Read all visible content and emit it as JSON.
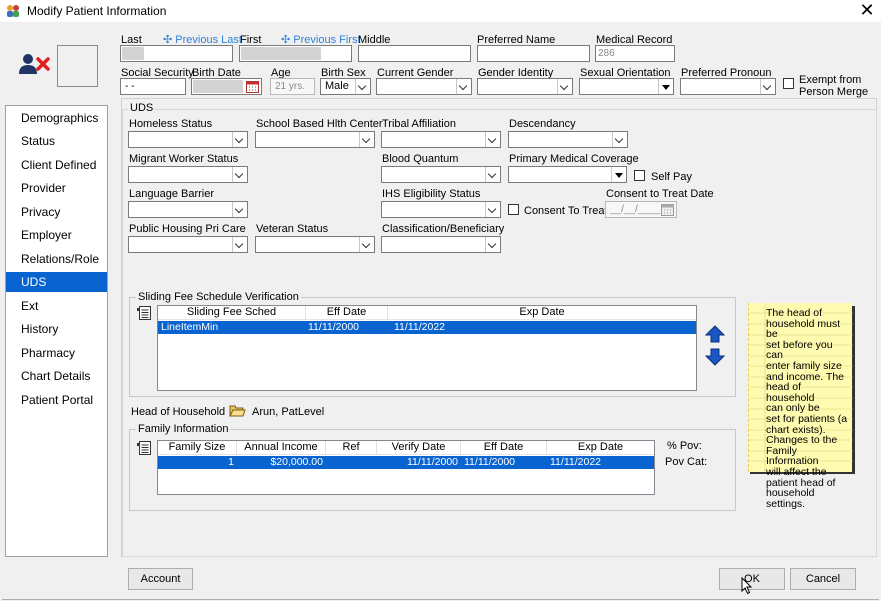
{
  "window": {
    "title": "Modify Patient Information",
    "close_label": "✕"
  },
  "header": {
    "last_label": "Last",
    "previous_last_link": "Previous Last",
    "first_label": "First",
    "previous_first_link": "Previous First",
    "middle_label": "Middle",
    "preferred_name_label": "Preferred Name",
    "medical_record_label": "Medical Record",
    "medical_record_value": "286",
    "ssn_label": "Social Security",
    "ssn_value": "- -",
    "birth_date_label": "Birth Date",
    "age_label": "Age",
    "age_value": "21 yrs.",
    "birth_sex_label": "Birth Sex",
    "birth_sex_value": "Male",
    "current_gender_label": "Current Gender",
    "gender_identity_label": "Gender Identity",
    "sexual_orientation_label": "Sexual Orientation",
    "preferred_pronoun_label": "Preferred Pronoun",
    "exempt_label_line1": "Exempt from",
    "exempt_label_line2": "Person Merge"
  },
  "sidebar": {
    "items": [
      {
        "label": "Demographics"
      },
      {
        "label": "Status"
      },
      {
        "label": "Client Defined"
      },
      {
        "label": "Provider"
      },
      {
        "label": "Privacy"
      },
      {
        "label": "Employer"
      },
      {
        "label": "Relations/Role"
      },
      {
        "label": "UDS"
      },
      {
        "label": "Ext"
      },
      {
        "label": "History"
      },
      {
        "label": "Pharmacy"
      },
      {
        "label": "Chart Details"
      },
      {
        "label": "Patient Portal"
      }
    ],
    "active": "UDS"
  },
  "uds": {
    "group_title": "UDS",
    "homeless_status": "Homeless Status",
    "school_based": "School Based Hlth Center",
    "tribal_affiliation": "Tribal Affiliation",
    "descendancy": "Descendancy",
    "migrant_worker": "Migrant Worker Status",
    "blood_quantum": "Blood Quantum",
    "primary_medical_coverage": "Primary Medical Coverage",
    "self_pay": "Self Pay",
    "language_barrier": "Language Barrier",
    "ihs_eligibility": "IHS Eligibility Status",
    "consent_to_treat": "Consent To Treat",
    "consent_to_treat_date": "Consent to Treat Date",
    "consent_date_value": "__/__/____",
    "public_housing": "Public Housing Pri Care",
    "veteran_status": "Veteran Status",
    "classification": "Classification/Beneficiary"
  },
  "sliding_fee": {
    "group_title": "Sliding Fee Schedule Verification",
    "columns": [
      "Sliding Fee Sched",
      "Eff Date",
      "Exp Date"
    ],
    "rows": [
      {
        "sched": "LineItemMin",
        "eff": "11/11/2000",
        "exp": "11/11/2022"
      }
    ]
  },
  "head_of_household": {
    "label": "Head of Household",
    "value": "Arun, PatLevel"
  },
  "family_info": {
    "group_title": "Family Information",
    "columns": [
      "Family Size",
      "Annual Income",
      "Ref",
      "Verify Date",
      "Eff Date",
      "Exp Date"
    ],
    "rows": [
      {
        "family_size": "1",
        "income": "$20,000.00",
        "ref": "",
        "verify": "11/11/2000",
        "eff": "11/11/2000",
        "exp": "11/11/2022"
      }
    ],
    "pct_pov_label": "% Pov:",
    "pov_cat_label": "Pov Cat:"
  },
  "note": {
    "lines": [
      "The head of",
      "household must be",
      "set before you can",
      "enter family size",
      "and income.  The",
      "head of household",
      "can only be",
      "set for patients (a",
      "chart exists).",
      "Changes to the",
      "Family Information",
      "will affect the",
      "patient head of",
      "household",
      "settings."
    ]
  },
  "buttons": {
    "account": "Account",
    "ok": "OK",
    "cancel": "Cancel"
  },
  "icons": [
    "app-icon",
    "patient-remove-icon",
    "close-icon",
    "grid-menu-icon",
    "arrow-up-icon",
    "arrow-down-icon",
    "folder-open-icon",
    "calendar-icon",
    "dropdown-arrow-icon",
    "cursor-icon"
  ],
  "colors": {
    "accent": "#0a64d0",
    "link": "#2f82d6",
    "patient_icon_red": "#e02020",
    "patient_icon_navy": "#1f3566",
    "note_bg": "#fffbb0"
  }
}
